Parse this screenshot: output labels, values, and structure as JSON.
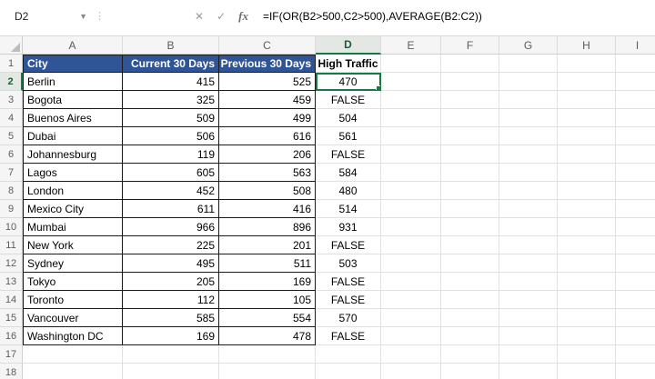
{
  "formula_bar": {
    "name_box": "D2",
    "cancel": "✕",
    "confirm": "✓",
    "fx": "fx",
    "formula": "=IF(OR(B2>500,C2>500),AVERAGE(B2:C2))"
  },
  "sheet": {
    "columns": [
      "A",
      "B",
      "C",
      "D",
      "E",
      "F",
      "G",
      "H",
      "I"
    ],
    "row_count": 18,
    "selected_cell": "D2",
    "selected_column": "D",
    "selected_row": 2,
    "header_row": {
      "city": "City",
      "current": "Current 30 Days",
      "previous": "Previous 30 Days",
      "high": "High Traffic"
    },
    "records": [
      {
        "city": "Berlin",
        "current": "415",
        "previous": "525",
        "high": "470"
      },
      {
        "city": "Bogota",
        "current": "325",
        "previous": "459",
        "high": "FALSE"
      },
      {
        "city": "Buenos Aires",
        "current": "509",
        "previous": "499",
        "high": "504"
      },
      {
        "city": "Dubai",
        "current": "506",
        "previous": "616",
        "high": "561"
      },
      {
        "city": "Johannesburg",
        "current": "119",
        "previous": "206",
        "high": "FALSE"
      },
      {
        "city": "Lagos",
        "current": "605",
        "previous": "563",
        "high": "584"
      },
      {
        "city": "London",
        "current": "452",
        "previous": "508",
        "high": "480"
      },
      {
        "city": "Mexico City",
        "current": "611",
        "previous": "416",
        "high": "514"
      },
      {
        "city": "Mumbai",
        "current": "966",
        "previous": "896",
        "high": "931"
      },
      {
        "city": "New York",
        "current": "225",
        "previous": "201",
        "high": "FALSE"
      },
      {
        "city": "Sydney",
        "current": "495",
        "previous": "511",
        "high": "503"
      },
      {
        "city": "Tokyo",
        "current": "205",
        "previous": "169",
        "high": "FALSE"
      },
      {
        "city": "Toronto",
        "current": "112",
        "previous": "105",
        "high": "FALSE"
      },
      {
        "city": "Vancouver",
        "current": "585",
        "previous": "554",
        "high": "570"
      },
      {
        "city": "Washington DC",
        "current": "169",
        "previous": "478",
        "high": "FALSE"
      }
    ]
  },
  "colors": {
    "header_fill": "#2F5597",
    "header_text": "#FFFFFF",
    "selection_green": "#107C41",
    "gridline": "#E1E1E1",
    "heading_bg": "#F5F5F5",
    "heading_selected_bg": "#E3E8E5"
  }
}
